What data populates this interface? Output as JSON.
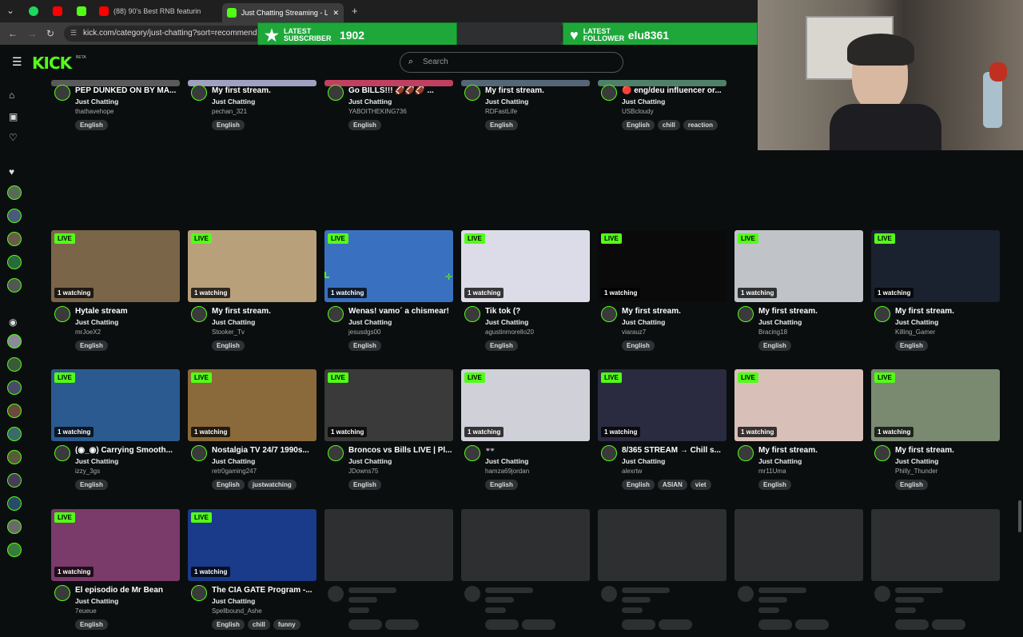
{
  "browser": {
    "tabs": [
      {
        "label": "(88) 90's Best RNB featurin"
      },
      {
        "label": "Just Chatting Streaming - Live"
      }
    ],
    "url": "kick.com/category/just-chatting?sort=recommended"
  },
  "overlay": {
    "subscriber_label": "LATEST SUBSCRIBER",
    "subscriber_name": "1902",
    "follower_label": "LATEST FOLLOWER",
    "follower_name": "elu8361"
  },
  "header": {
    "logo": "KICK",
    "logo_tag": "BETA",
    "search_placeholder": "Search"
  },
  "rows": [
    [
      {
        "title": "PEP DUNKED ON BY MA...",
        "cat": "Just Chatting",
        "chan": "thathavehope",
        "tags": [
          "English"
        ]
      },
      {
        "title": "My first stream.",
        "cat": "Just Chatting",
        "chan": "pechan_321",
        "tags": [
          "English"
        ]
      },
      {
        "title": "Go BILLS!!! 🏈🏈🏈 ...",
        "cat": "Just Chatting",
        "chan": "YABOITHEKING736",
        "tags": [
          "English"
        ]
      },
      {
        "title": "My first stream.",
        "cat": "Just Chatting",
        "chan": "RDFastLife",
        "tags": [
          "English"
        ]
      },
      {
        "title": "🔴 eng/deu influencer or...",
        "cat": "Just Chatting",
        "chan": "USBcloudy",
        "tags": [
          "English",
          "chill",
          "reaction"
        ]
      }
    ],
    [
      {
        "title": "Hytale stream",
        "cat": "Just Chatting",
        "chan": "mrJoeX2",
        "tags": [
          "English"
        ],
        "watching": "1 watching"
      },
      {
        "title": "My first stream.",
        "cat": "Just Chatting",
        "chan": "Stooker_Tv",
        "tags": [
          "English"
        ],
        "watching": "1 watching"
      },
      {
        "title": "Wenas! vamo´ a chismear!",
        "cat": "Just Chatting",
        "chan": "jesusdgs00",
        "tags": [
          "English"
        ],
        "watching": "1 watching"
      },
      {
        "title": "Tik tok (?",
        "cat": "Just Chatting",
        "chan": "agustinmorello20",
        "tags": [
          "English"
        ],
        "watching": "1 watching"
      },
      {
        "title": "My first stream.",
        "cat": "Just Chatting",
        "chan": "viarauz7",
        "tags": [
          "English"
        ],
        "watching": "1 watching"
      },
      {
        "title": "My first stream.",
        "cat": "Just Chatting",
        "chan": "Bracing18",
        "tags": [
          "English"
        ],
        "watching": "1 watching"
      },
      {
        "title": "My first stream.",
        "cat": "Just Chatting",
        "chan": "Killing_Gamer",
        "tags": [
          "English"
        ],
        "watching": "1 watching"
      }
    ],
    [
      {
        "title": "(◉_◉) Carrying Smooth...",
        "cat": "Just Chatting",
        "chan": "izzy_3gs",
        "tags": [
          "English"
        ],
        "watching": "1 watching"
      },
      {
        "title": "Nostalgia TV 24/7 1990s...",
        "cat": "Just Chatting",
        "chan": "retr0gaming247",
        "tags": [
          "English",
          "justwatching"
        ],
        "watching": "1 watching"
      },
      {
        "title": "Broncos vs Bills LIVE | Pl...",
        "cat": "Just Chatting",
        "chan": "JDowns75",
        "tags": [
          "English"
        ],
        "watching": "1 watching"
      },
      {
        "title": "👓",
        "cat": "Just Chatting",
        "chan": "hamza69jordan",
        "tags": [
          "English"
        ],
        "watching": "1 watching"
      },
      {
        "title": "8/365 STREAM → Chill s...",
        "cat": "Just Chatting",
        "chan": "alexrtw",
        "tags": [
          "English",
          "ASIAN",
          "viet"
        ],
        "watching": "1 watching"
      },
      {
        "title": "My first stream.",
        "cat": "Just Chatting",
        "chan": "mr11Uma",
        "tags": [
          "English"
        ],
        "watching": "1 watching"
      },
      {
        "title": "My first stream.",
        "cat": "Just Chatting",
        "chan": "Philly_Thunder",
        "tags": [
          "English"
        ],
        "watching": "1 watching"
      }
    ],
    [
      {
        "title": "El episodio de Mr Bean",
        "cat": "Just Chatting",
        "chan": "7eueue",
        "tags": [
          "English"
        ],
        "watching": "1 watching"
      },
      {
        "title": "The CIA GATE Program -...",
        "cat": "Just Chatting",
        "chan": "Spellbound_Ashe",
        "tags": [
          "English",
          "chill",
          "funny"
        ],
        "watching": "1 watching"
      }
    ]
  ],
  "live_label": "LIVE",
  "colors": {
    "accent": "#53fc18",
    "bg": "#0b0e0f",
    "skeleton": "#2d2f31"
  },
  "thumb_colors": [
    [
      "#5a5a5a",
      "#a0a0c0",
      "#c04060",
      "#556677",
      "#50806a",
      "#2a3a3a",
      "#1a2a3a"
    ],
    [
      "#7a6548",
      "#b8a07a",
      "#3a70c0",
      "#dcdce8",
      "#0a0a0a",
      "#c0c4c8",
      "#1a2230"
    ],
    [
      "#2a5a90",
      "#8a6a3a",
      "#3a3a3a",
      "#d0d0d8",
      "#2a2a40",
      "#d8c0b8",
      "#7a8a70"
    ],
    [
      "#7a3a6a",
      "#1a3a8a"
    ]
  ]
}
